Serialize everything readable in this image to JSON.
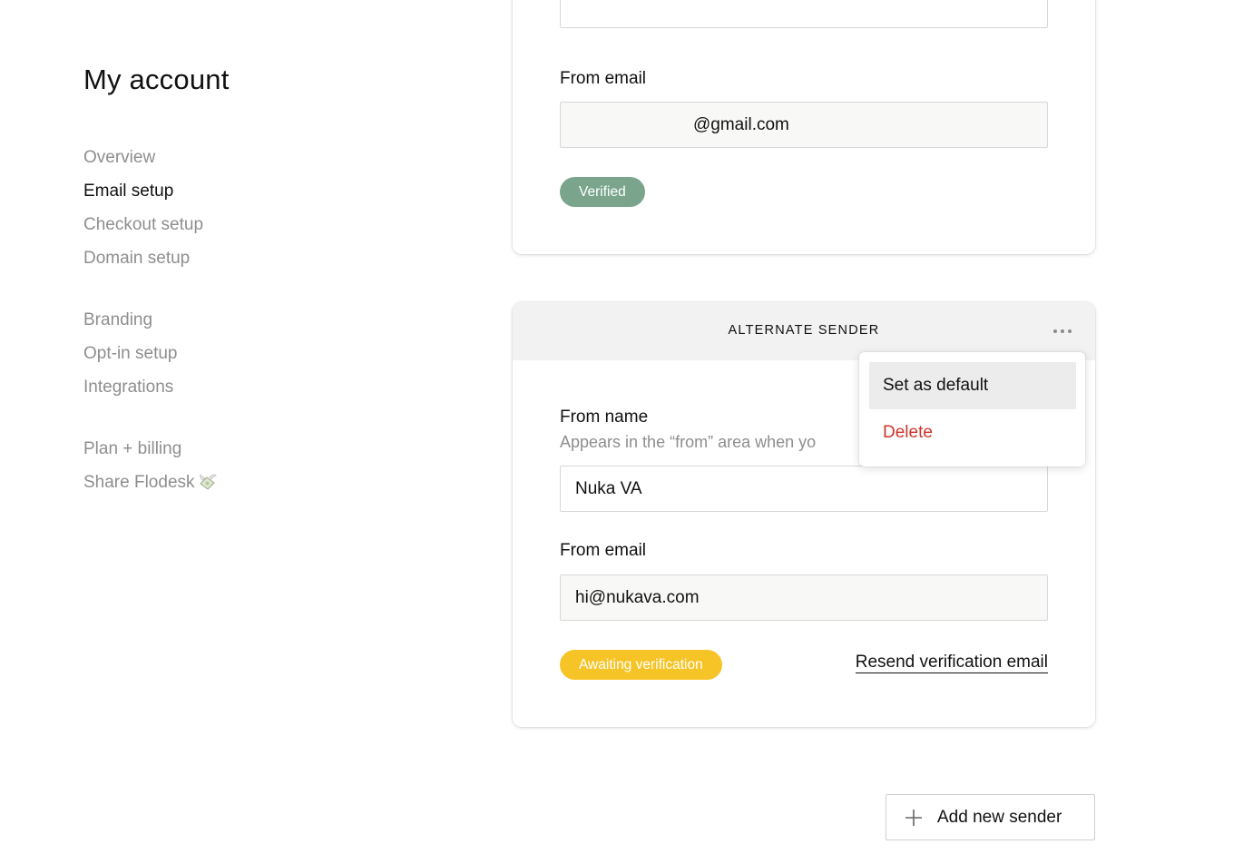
{
  "page": {
    "title": "My account"
  },
  "sidebar": {
    "groups": [
      {
        "items": [
          {
            "label": "Overview",
            "active": false
          },
          {
            "label": "Email setup",
            "active": true
          },
          {
            "label": "Checkout setup",
            "active": false
          },
          {
            "label": "Domain setup",
            "active": false
          }
        ]
      },
      {
        "items": [
          {
            "label": "Branding",
            "active": false
          },
          {
            "label": "Opt-in setup",
            "active": false
          },
          {
            "label": "Integrations",
            "active": false
          }
        ]
      },
      {
        "items": [
          {
            "label": "Plan + billing",
            "active": false
          },
          {
            "label": "Share Flodesk",
            "active": false,
            "icon": "money-with-wings-icon"
          }
        ]
      }
    ]
  },
  "primary_sender": {
    "from_name_value": "",
    "from_email_label": "From email",
    "from_email_value": "@gmail.com",
    "status": "Verified"
  },
  "alternate_sender": {
    "header": "ALTERNATE SENDER",
    "from_name_label": "From name",
    "from_name_help": "Appears in the “from” area when yo",
    "from_name_value": "Nuka VA",
    "from_email_label": "From email",
    "from_email_value": "hi@nukava.com",
    "status": "Awaiting verification",
    "resend_label": "Resend verification email"
  },
  "menu": {
    "set_default_label": "Set as default",
    "delete_label": "Delete"
  },
  "add_sender": {
    "label": "Add new sender"
  },
  "colors": {
    "verified_badge": "#7aa58c",
    "awaiting_badge": "#f7c427",
    "delete_text": "#d0342c",
    "muted_text": "#8e8e8e"
  }
}
